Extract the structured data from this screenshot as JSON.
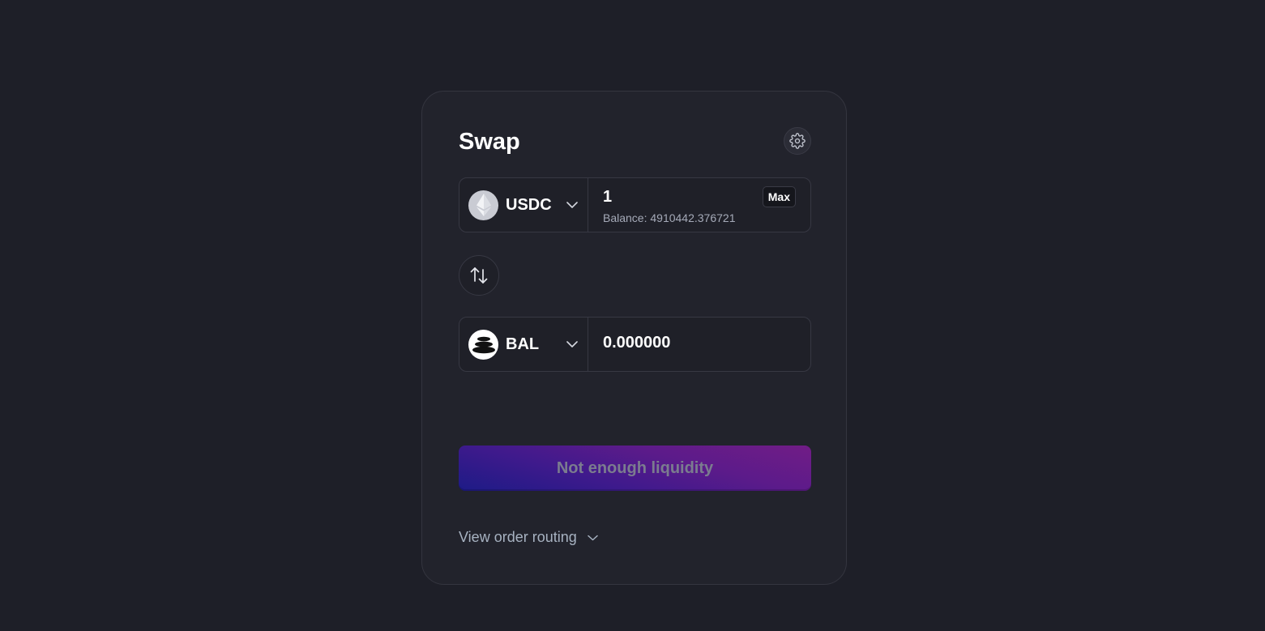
{
  "swap": {
    "title": "Swap",
    "settings_icon": "gear-icon",
    "from": {
      "token_symbol": "USDC",
      "token_icon": "ethereum-icon",
      "amount": "1",
      "balance_text": "Balance: 4910442.376721",
      "max_label": "Max"
    },
    "switch_icon": "arrows-up-down-icon",
    "to": {
      "token_symbol": "BAL",
      "token_icon": "balancer-icon",
      "amount": "0.000000"
    },
    "action_label": "Not enough liquidity",
    "routing_label": "View order routing"
  },
  "colors": {
    "background": "#1e1f28",
    "card": "#22232c",
    "accent_gradient_start": "#1d1b86",
    "accent_gradient_end": "#711c86",
    "muted_text": "#a5aab8"
  }
}
